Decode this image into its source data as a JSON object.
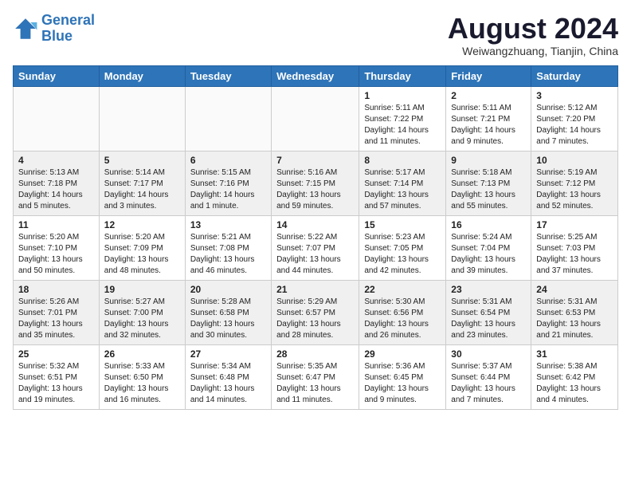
{
  "logo": {
    "line1": "General",
    "line2": "Blue"
  },
  "title": "August 2024",
  "location": "Weiwangzhuang, Tianjin, China",
  "days_of_week": [
    "Sunday",
    "Monday",
    "Tuesday",
    "Wednesday",
    "Thursday",
    "Friday",
    "Saturday"
  ],
  "weeks": [
    [
      {
        "day": "",
        "info": ""
      },
      {
        "day": "",
        "info": ""
      },
      {
        "day": "",
        "info": ""
      },
      {
        "day": "",
        "info": ""
      },
      {
        "day": "1",
        "info": "Sunrise: 5:11 AM\nSunset: 7:22 PM\nDaylight: 14 hours\nand 11 minutes."
      },
      {
        "day": "2",
        "info": "Sunrise: 5:11 AM\nSunset: 7:21 PM\nDaylight: 14 hours\nand 9 minutes."
      },
      {
        "day": "3",
        "info": "Sunrise: 5:12 AM\nSunset: 7:20 PM\nDaylight: 14 hours\nand 7 minutes."
      }
    ],
    [
      {
        "day": "4",
        "info": "Sunrise: 5:13 AM\nSunset: 7:18 PM\nDaylight: 14 hours\nand 5 minutes."
      },
      {
        "day": "5",
        "info": "Sunrise: 5:14 AM\nSunset: 7:17 PM\nDaylight: 14 hours\nand 3 minutes."
      },
      {
        "day": "6",
        "info": "Sunrise: 5:15 AM\nSunset: 7:16 PM\nDaylight: 14 hours\nand 1 minute."
      },
      {
        "day": "7",
        "info": "Sunrise: 5:16 AM\nSunset: 7:15 PM\nDaylight: 13 hours\nand 59 minutes."
      },
      {
        "day": "8",
        "info": "Sunrise: 5:17 AM\nSunset: 7:14 PM\nDaylight: 13 hours\nand 57 minutes."
      },
      {
        "day": "9",
        "info": "Sunrise: 5:18 AM\nSunset: 7:13 PM\nDaylight: 13 hours\nand 55 minutes."
      },
      {
        "day": "10",
        "info": "Sunrise: 5:19 AM\nSunset: 7:12 PM\nDaylight: 13 hours\nand 52 minutes."
      }
    ],
    [
      {
        "day": "11",
        "info": "Sunrise: 5:20 AM\nSunset: 7:10 PM\nDaylight: 13 hours\nand 50 minutes."
      },
      {
        "day": "12",
        "info": "Sunrise: 5:20 AM\nSunset: 7:09 PM\nDaylight: 13 hours\nand 48 minutes."
      },
      {
        "day": "13",
        "info": "Sunrise: 5:21 AM\nSunset: 7:08 PM\nDaylight: 13 hours\nand 46 minutes."
      },
      {
        "day": "14",
        "info": "Sunrise: 5:22 AM\nSunset: 7:07 PM\nDaylight: 13 hours\nand 44 minutes."
      },
      {
        "day": "15",
        "info": "Sunrise: 5:23 AM\nSunset: 7:05 PM\nDaylight: 13 hours\nand 42 minutes."
      },
      {
        "day": "16",
        "info": "Sunrise: 5:24 AM\nSunset: 7:04 PM\nDaylight: 13 hours\nand 39 minutes."
      },
      {
        "day": "17",
        "info": "Sunrise: 5:25 AM\nSunset: 7:03 PM\nDaylight: 13 hours\nand 37 minutes."
      }
    ],
    [
      {
        "day": "18",
        "info": "Sunrise: 5:26 AM\nSunset: 7:01 PM\nDaylight: 13 hours\nand 35 minutes."
      },
      {
        "day": "19",
        "info": "Sunrise: 5:27 AM\nSunset: 7:00 PM\nDaylight: 13 hours\nand 32 minutes."
      },
      {
        "day": "20",
        "info": "Sunrise: 5:28 AM\nSunset: 6:58 PM\nDaylight: 13 hours\nand 30 minutes."
      },
      {
        "day": "21",
        "info": "Sunrise: 5:29 AM\nSunset: 6:57 PM\nDaylight: 13 hours\nand 28 minutes."
      },
      {
        "day": "22",
        "info": "Sunrise: 5:30 AM\nSunset: 6:56 PM\nDaylight: 13 hours\nand 26 minutes."
      },
      {
        "day": "23",
        "info": "Sunrise: 5:31 AM\nSunset: 6:54 PM\nDaylight: 13 hours\nand 23 minutes."
      },
      {
        "day": "24",
        "info": "Sunrise: 5:31 AM\nSunset: 6:53 PM\nDaylight: 13 hours\nand 21 minutes."
      }
    ],
    [
      {
        "day": "25",
        "info": "Sunrise: 5:32 AM\nSunset: 6:51 PM\nDaylight: 13 hours\nand 19 minutes."
      },
      {
        "day": "26",
        "info": "Sunrise: 5:33 AM\nSunset: 6:50 PM\nDaylight: 13 hours\nand 16 minutes."
      },
      {
        "day": "27",
        "info": "Sunrise: 5:34 AM\nSunset: 6:48 PM\nDaylight: 13 hours\nand 14 minutes."
      },
      {
        "day": "28",
        "info": "Sunrise: 5:35 AM\nSunset: 6:47 PM\nDaylight: 13 hours\nand 11 minutes."
      },
      {
        "day": "29",
        "info": "Sunrise: 5:36 AM\nSunset: 6:45 PM\nDaylight: 13 hours\nand 9 minutes."
      },
      {
        "day": "30",
        "info": "Sunrise: 5:37 AM\nSunset: 6:44 PM\nDaylight: 13 hours\nand 7 minutes."
      },
      {
        "day": "31",
        "info": "Sunrise: 5:38 AM\nSunset: 6:42 PM\nDaylight: 13 hours\nand 4 minutes."
      }
    ]
  ]
}
